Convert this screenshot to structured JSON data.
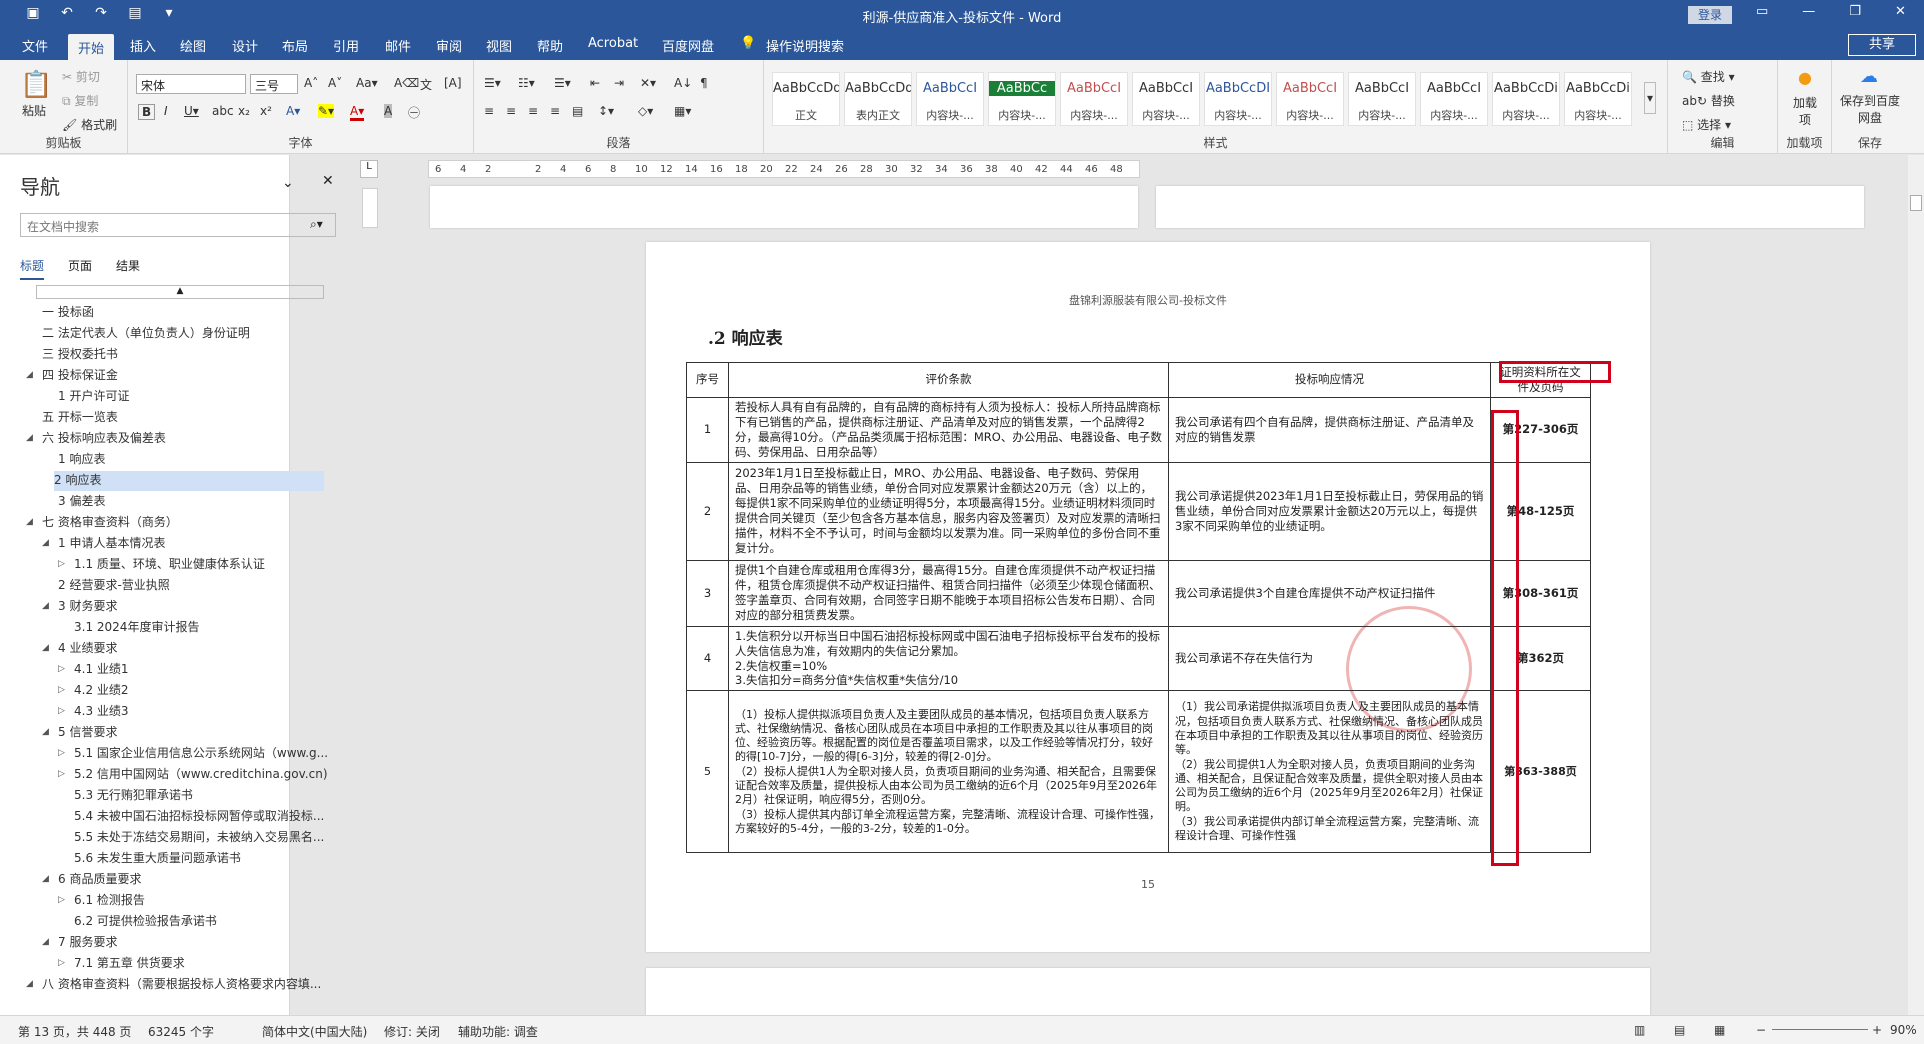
{
  "titlebar": {
    "title": "利源-供应商准入-投标文件 - Word",
    "login": "登录"
  },
  "ribbon_tabs": [
    "文件",
    "开始",
    "插入",
    "绘图",
    "设计",
    "布局",
    "引用",
    "邮件",
    "审阅",
    "视图",
    "帮助",
    "Acrobat",
    "百度网盘",
    "操作说明搜索"
  ],
  "share": "共享",
  "clipboard": {
    "paste": "粘贴",
    "cut": "剪切",
    "copy": "复制",
    "format_painter": "格式刷",
    "label": "剪贴板"
  },
  "font": {
    "name": "宋体",
    "size": "三号",
    "label": "字体"
  },
  "paragraph": {
    "label": "段落"
  },
  "styles": {
    "label": "样式",
    "items": [
      {
        "preview": "AaBbCcDd",
        "name": "正文"
      },
      {
        "preview": "AaBbCcDdI",
        "name": "表内正文"
      },
      {
        "preview": "AaBbCcI",
        "name": "内容块-..."
      },
      {
        "preview": "AaBbCc",
        "name": "内容块-..."
      },
      {
        "preview": "AaBbCcI",
        "name": "内容块-..."
      },
      {
        "preview": "AaBbCcI",
        "name": "内容块-..."
      },
      {
        "preview": "AaBbCcDI",
        "name": "内容块-..."
      },
      {
        "preview": "AaBbCcI",
        "name": "内容块-..."
      },
      {
        "preview": "AaBbCcI",
        "name": "内容块-..."
      },
      {
        "preview": "AaBbCcI",
        "name": "内容块-..."
      },
      {
        "preview": "AaBbCcDi",
        "name": "内容块-..."
      },
      {
        "preview": "AaBbCcDi",
        "name": "内容块-..."
      }
    ]
  },
  "editing": {
    "find": "查找",
    "replace": "替换",
    "select": "选择",
    "label": "编辑"
  },
  "addins": {
    "name": "加载项",
    "label": "加载项"
  },
  "save": {
    "name": "保存到百度网盘",
    "label": "保存"
  },
  "nav": {
    "title": "导航",
    "search_placeholder": "在文档中搜索",
    "tabs": [
      "标题",
      "页面",
      "结果"
    ],
    "items": [
      {
        "text": "一 投标函",
        "level": 1,
        "tri": ""
      },
      {
        "text": "二 法定代表人（单位负责人）身份证明",
        "level": 1,
        "tri": ""
      },
      {
        "text": "三 授权委托书",
        "level": 1,
        "tri": ""
      },
      {
        "text": "四 投标保证金",
        "level": 1,
        "tri": "◢"
      },
      {
        "text": "1 开户许可证",
        "level": 2,
        "tri": ""
      },
      {
        "text": "五 开标一览表",
        "level": 1,
        "tri": ""
      },
      {
        "text": "六 投标响应表及偏差表",
        "level": 1,
        "tri": "◢"
      },
      {
        "text": "1 响应表",
        "level": 2,
        "tri": ""
      },
      {
        "text": "2 响应表",
        "level": 2,
        "tri": "",
        "selected": true
      },
      {
        "text": "3 偏差表",
        "level": 2,
        "tri": ""
      },
      {
        "text": "七 资格审查资料（商务）",
        "level": 1,
        "tri": "◢"
      },
      {
        "text": "1 申请人基本情况表",
        "level": 2,
        "tri": "◢"
      },
      {
        "text": "1.1 质量、环境、职业健康体系认证",
        "level": 3,
        "tri": "▷"
      },
      {
        "text": "2 经营要求-营业执照",
        "level": 2,
        "tri": ""
      },
      {
        "text": "3 财务要求",
        "level": 2,
        "tri": "◢"
      },
      {
        "text": "3.1 2024年度审计报告",
        "level": 3,
        "tri": ""
      },
      {
        "text": "4 业绩要求",
        "level": 2,
        "tri": "◢"
      },
      {
        "text": "4.1 业绩1",
        "level": 3,
        "tri": "▷"
      },
      {
        "text": "4.2 业绩2",
        "level": 3,
        "tri": "▷"
      },
      {
        "text": "4.3 业绩3",
        "level": 3,
        "tri": "▷"
      },
      {
        "text": "5 信誉要求",
        "level": 2,
        "tri": "◢"
      },
      {
        "text": "5.1 国家企业信用信息公示系统网站（www.g...",
        "level": 3,
        "tri": "▷"
      },
      {
        "text": "5.2 信用中国网站（www.creditchina.gov.cn)",
        "level": 3,
        "tri": "▷"
      },
      {
        "text": "5.3 无行贿犯罪承诺书",
        "level": 3,
        "tri": ""
      },
      {
        "text": "5.4 未被中国石油招标投标网暂停或取消投标...",
        "level": 3,
        "tri": ""
      },
      {
        "text": "5.5 未处于冻结交易期间，未被纳入交易黑名...",
        "level": 3,
        "tri": ""
      },
      {
        "text": "5.6 未发生重大质量问题承诺书",
        "level": 3,
        "tri": ""
      },
      {
        "text": "6 商品质量要求",
        "level": 2,
        "tri": "◢"
      },
      {
        "text": "6.1 检测报告",
        "level": 3,
        "tri": "▷"
      },
      {
        "text": "6.2 可提供检验报告承诺书",
        "level": 3,
        "tri": ""
      },
      {
        "text": "7 服务要求",
        "level": 2,
        "tri": "◢"
      },
      {
        "text": "7.1 第五章 供货要求",
        "level": 3,
        "tri": "▷"
      },
      {
        "text": "八 资格审查资料（需要根据投标人资格要求内容填...",
        "level": 1,
        "tri": "◢"
      }
    ]
  },
  "document": {
    "header": "盘锦利源服装有限公司-投标文件",
    "heading": ".2  响应表",
    "columns": [
      "序号",
      "评价条款",
      "投标响应情况",
      "证明资料所在文件及页码"
    ],
    "rows": [
      {
        "no": "1",
        "clause": "若投标人具有自有品牌的，自有品牌的商标持有人须为投标人：投标人所持品牌商标下有已销售的产品，提供商标注册证、产品清单及对应的销售发票，一个品牌得2分，最高得10分。（产品品类须属于招标范围：MRO、办公用品、电器设备、电子数码、劳保用品、日用杂品等）",
        "response": "我公司承诺有四个自有品牌，提供商标注册证、产品清单及对应的销售发票",
        "page": "第227-306页"
      },
      {
        "no": "2",
        "clause": "2023年1月1日至投标截止日，MRO、办公用品、电器设备、电子数码、劳保用品、日用杂品等的销售业绩，单份合同对应发票累计金额达20万元（含）以上的，每提供1家不同采购单位的业绩证明得5分，本项最高得15分。业绩证明材料须同时提供合同关键页（至少包含各方基本信息，服务内容及签署页）及对应发票的清晰扫描件，材料不全不予认可，时间与金额均以发票为准。同一采购单位的多份合同不重复计分。",
        "response": "我公司承诺提供2023年1月1日至投标截止日，劳保用品的销售业绩，单份合同对应发票累计金额达20万元以上，每提供3家不同采购单位的业绩证明。",
        "page": "第48-125页"
      },
      {
        "no": "3",
        "clause": "提供1个自建仓库或租用仓库得3分，最高得15分。自建仓库须提供不动产权证扫描件，租赁仓库须提供不动产权证扫描件、租赁合同扫描件（必须至少体现仓储面积、签字盖章页、合同有效期，合同签字日期不能晚于本项目招标公告发布日期）、合同对应的部分租赁费发票。",
        "response": "我公司承诺提供3个自建仓库提供不动产权证扫描件",
        "page": "第308-361页"
      },
      {
        "no": "4",
        "clause": "1.失信积分以开标当日中国石油招标投标网或中国石油电子招标投标平台发布的投标人失信信息为准，有效期内的失信记分累加。\n2.失信权重=10%\n3.失信扣分=商务分值*失信权重*失信分/10",
        "response": "我公司承诺不存在失信行为",
        "page": "第362页"
      },
      {
        "no": "5",
        "clause": "（1）投标人提供拟派项目负责人及主要团队成员的基本情况，包括项目负责人联系方式、社保缴纳情况、备核心团队成员在本项目中承担的工作职责及其以往从事项目的岗位、经验资历等。根据配置的岗位是否覆盖项目需求，以及工作经验等情况打分，较好的得[10-7]分，一般的得[6-3]分，较差的得[2-0]分。\n（2）投标人提供1人为全职对接人员，负责项目期间的业务沟通、相关配合，且需要保证配合效率及质量，提供投标人由本公司为员工缴纳的近6个月（2025年9月至2026年2月）社保证明，响应得5分，否则0分。\n（3）投标人提供其内部订单全流程运营方案，完整清晰、流程设计合理、可操作性强，方案较好的5-4分，一般的3-2分，较差的1-0分。",
        "response": "（1）我公司承诺提供拟派项目负责人及主要团队成员的基本情况，包括项目负责人联系方式、社保缴纳情况、备核心团队成员在本项目中承担的工作职责及其以往从事项目的岗位、经验资历等。\n（2）我公司提供1人为全职对接人员，负责项目期间的业务沟通、相关配合，且保证配合效率及质量，提供全职对接人员由本公司为员工缴纳的近6个月（2025年9月至2026年2月）社保证明。\n（3）我公司承诺提供内部订单全流程运营方案，完整清晰、流程设计合理、可操作性强",
        "page": "第363-388页"
      }
    ],
    "footer_page": "15"
  },
  "ruler_ticks": [
    "6",
    "4",
    "2",
    "",
    "2",
    "4",
    "6",
    "8",
    "10",
    "12",
    "14",
    "16",
    "18",
    "20",
    "22",
    "24",
    "26",
    "28",
    "30",
    "32",
    "34",
    "36",
    "38",
    "40",
    "42",
    "44",
    "46",
    "48"
  ],
  "status": {
    "page": "第 13 页，共 448 页",
    "words": "63245 个字",
    "language": "简体中文(中国大陆)",
    "track": "修订: 关闭",
    "accessibility": "辅助功能: 调查",
    "zoom": "90%"
  }
}
